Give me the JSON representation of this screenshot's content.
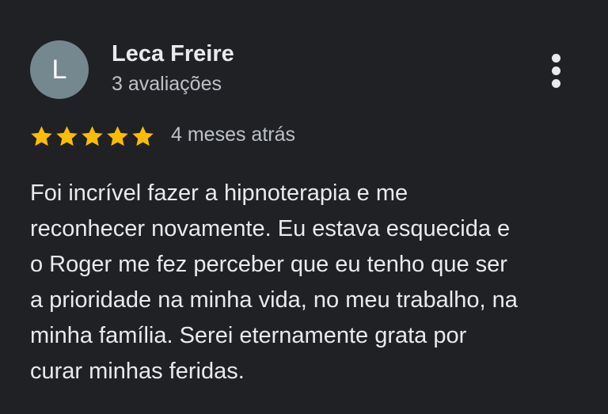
{
  "reviewer": {
    "initial": "L",
    "name": "Leca Freire",
    "review_count": "3 avaliações",
    "avatar_color": "#75878f"
  },
  "menu": {
    "icon": "more-vertical-icon"
  },
  "rating": {
    "stars": 5,
    "max_stars": 5,
    "star_color": "#fbbc04",
    "date": "4 meses atrás"
  },
  "review": {
    "lines": [
      "Foi incrível fazer a hipnoterapia e me",
      "reconhecer novamente. Eu estava esquecida e",
      "o Roger me fez perceber que eu tenho que ser",
      "a prioridade na minha vida, no meu trabalho, na",
      "minha família. Serei eternamente grata por",
      "curar minhas feridas."
    ]
  }
}
